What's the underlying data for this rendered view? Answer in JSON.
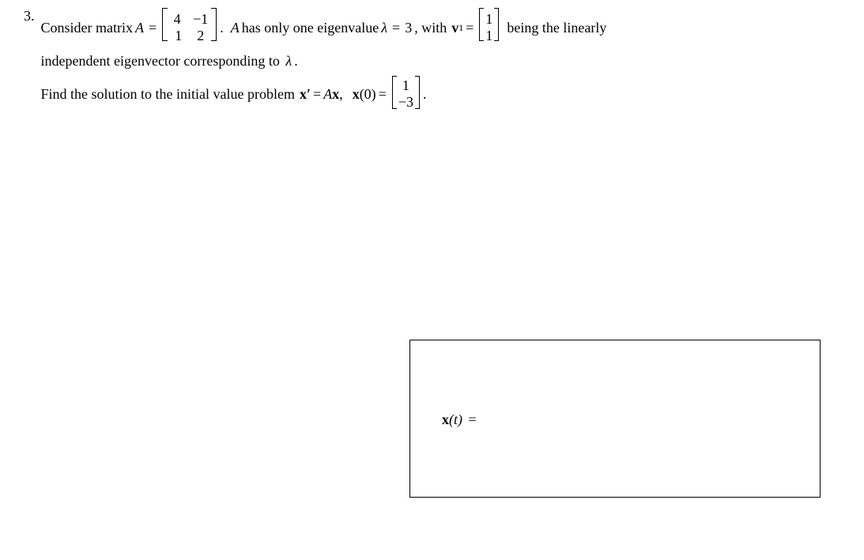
{
  "problem": {
    "number": "3.",
    "text1_a": "Consider matrix",
    "text1_b": ".",
    "text1_c": "has only one eigenvalue",
    "text1_d": ", with",
    "text1_e": "being the linearly",
    "text2": "independent eigenvector corresponding to",
    "text3": "Find the solution to the initial value problem",
    "symbols": {
      "A": "A",
      "lambda": "λ",
      "equals": "=",
      "lambda_val": "3",
      "v1": "v",
      "v1_sub": "1",
      "period": ".",
      "x_prime": "x′",
      "Ax": "Ax",
      "comma": ",",
      "x0": "x",
      "zero": "(0)"
    },
    "matrix_A": {
      "r1c1": "4",
      "r1c2": "−1",
      "r2c1": "1",
      "r2c2": "2"
    },
    "vec_v1": {
      "r1": "1",
      "r2": "1"
    },
    "vec_x0": {
      "r1": "1",
      "r2": "−3"
    }
  },
  "answer": {
    "label_x": "x",
    "label_t": "(t)",
    "label_eq": "="
  }
}
